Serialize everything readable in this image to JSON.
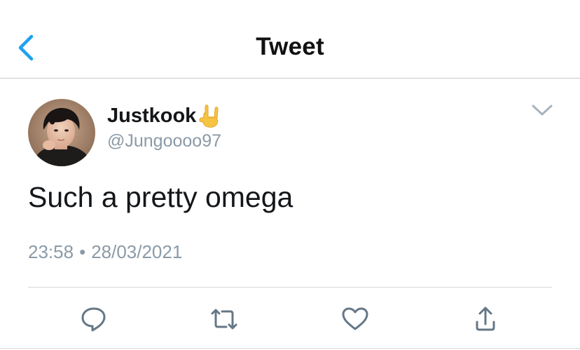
{
  "header": {
    "title": "Tweet",
    "back_icon": "chevron-left-icon",
    "accent_color": "#1da1f2"
  },
  "tweet": {
    "author": {
      "display_name": "Justkook",
      "name_emoji": "love-you-gesture-emoji",
      "handle": "@Jungoooo97"
    },
    "text": "Such a pretty omega",
    "time": "23:58",
    "separator": "•",
    "date": "28/03/2021",
    "more_icon": "chevron-down-icon"
  },
  "actions": [
    {
      "name": "reply",
      "icon": "speech-bubble-icon"
    },
    {
      "name": "retweet",
      "icon": "retweet-icon"
    },
    {
      "name": "like",
      "icon": "heart-icon"
    },
    {
      "name": "share",
      "icon": "share-icon"
    }
  ],
  "colors": {
    "text_primary": "#14171a",
    "text_secondary": "#8b9aa7",
    "icon_gray": "#657786"
  }
}
